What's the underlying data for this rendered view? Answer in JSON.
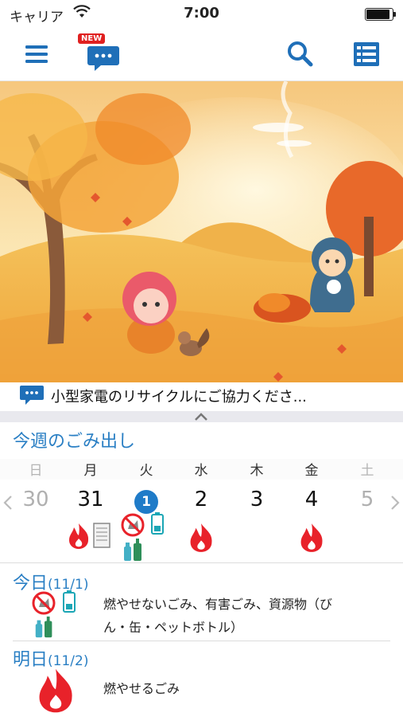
{
  "status": {
    "carrier": "キャリア",
    "time": "7:00",
    "battery_level": 0.95
  },
  "toolbar": {
    "new_badge": "NEW"
  },
  "notice": {
    "text": "小型家電のリサイクルにご協力くださ..."
  },
  "week": {
    "title": "今週のごみ出し",
    "days": [
      {
        "dow": "日",
        "date": "30",
        "weekend": true,
        "today": false
      },
      {
        "dow": "月",
        "date": "31",
        "weekend": false,
        "today": false
      },
      {
        "dow": "火",
        "date": "1",
        "weekend": false,
        "today": true
      },
      {
        "dow": "水",
        "date": "2",
        "weekend": false,
        "today": false
      },
      {
        "dow": "木",
        "date": "3",
        "weekend": false,
        "today": false
      },
      {
        "dow": "金",
        "date": "4",
        "weekend": false,
        "today": false
      },
      {
        "dow": "土",
        "date": "5",
        "weekend": true,
        "today": false
      }
    ]
  },
  "today": {
    "label": "今日",
    "date": "(11/1)",
    "line1": "燃やせないごみ、有害ごみ、資源物（び",
    "line2": "ん・缶・ペットボトル）"
  },
  "tomorrow": {
    "label": "明日",
    "date": "(11/2)",
    "text": "燃やせるごみ"
  },
  "colors": {
    "accent": "#2a7fc4",
    "icon_blue": "#1f6fb8",
    "flame": "#e8222a"
  }
}
